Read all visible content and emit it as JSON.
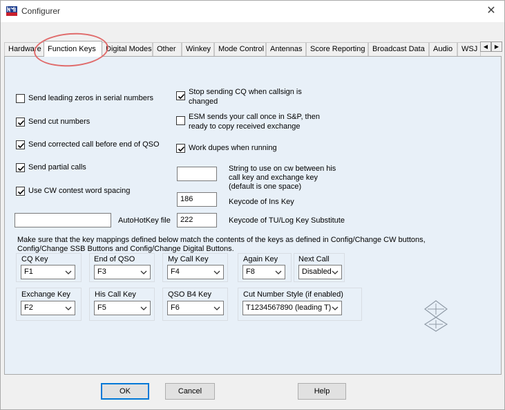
{
  "window": {
    "title": "Configurer",
    "close_symbol": "✕"
  },
  "tabs": [
    {
      "label": "Hardware"
    },
    {
      "label": "Function Keys"
    },
    {
      "label": "Digital Modes"
    },
    {
      "label": "Other"
    },
    {
      "label": "Winkey"
    },
    {
      "label": "Mode Control"
    },
    {
      "label": "Antennas"
    },
    {
      "label": "Score Reporting"
    },
    {
      "label": "Broadcast Data"
    },
    {
      "label": "Audio"
    },
    {
      "label": "WSJ"
    }
  ],
  "active_tab": "Function Keys",
  "options_left": [
    {
      "label": "Send leading zeros in serial numbers",
      "checked": false
    },
    {
      "label": "Send cut numbers",
      "checked": true
    },
    {
      "label": "Send corrected call before end of QSO",
      "checked": true
    },
    {
      "label": "Send partial calls",
      "checked": true
    },
    {
      "label": "Use CW contest word spacing",
      "checked": true
    }
  ],
  "options_right": [
    {
      "label_line1": "Stop sending CQ when callsign is",
      "label_line2": "changed",
      "checked": true
    },
    {
      "label_line1": "ESM sends your call once in S&P, then",
      "label_line2": "ready to copy received exchange",
      "checked": false
    },
    {
      "label_line1": "Work dupes when running",
      "label_line2": "",
      "checked": true
    }
  ],
  "cw_string": {
    "value": "",
    "label_line1": "String to use on cw between his",
    "label_line2": "call key and exchange key",
    "label_line3": "(default is one space)"
  },
  "ins_key": {
    "value": "186",
    "label": "Keycode of Ins Key"
  },
  "tu_key": {
    "value": "222",
    "label": "Keycode of TU/Log Key Substitute"
  },
  "autohotkey": {
    "value": "",
    "label": "AutoHotKey file"
  },
  "info_line1": "Make sure that the key mappings defined below match the contents of the keys as defined in Config/Change CW buttons,",
  "info_line2": "Config/Change SSB Buttons and Config/Change Digital Buttons.",
  "key_groups": {
    "cq_key": {
      "title": "CQ Key",
      "value": "F1"
    },
    "end_of_qso": {
      "title": "End of QSO",
      "value": "F3"
    },
    "my_call_key": {
      "title": "My Call Key",
      "value": "F4"
    },
    "again_key": {
      "title": "Again  Key",
      "value": "F8"
    },
    "next_call": {
      "title": "Next Call",
      "value": "Disabled"
    },
    "exchange_key": {
      "title": "Exchange  Key",
      "value": "F2"
    },
    "his_call_key": {
      "title": "His Call Key",
      "value": "F5"
    },
    "qso_b4_key": {
      "title": "QSO B4 Key",
      "value": "F6"
    },
    "cut_number_style": {
      "title": "Cut Number Style (if enabled)",
      "value": "T1234567890 (leading T)"
    }
  },
  "buttons": {
    "ok": "OK",
    "cancel": "Cancel",
    "help": "Help"
  },
  "colors": {
    "panel_bg": "#e8f0f8",
    "highlight_ring": "#e06b6b",
    "default_button_border": "#0078d7"
  }
}
